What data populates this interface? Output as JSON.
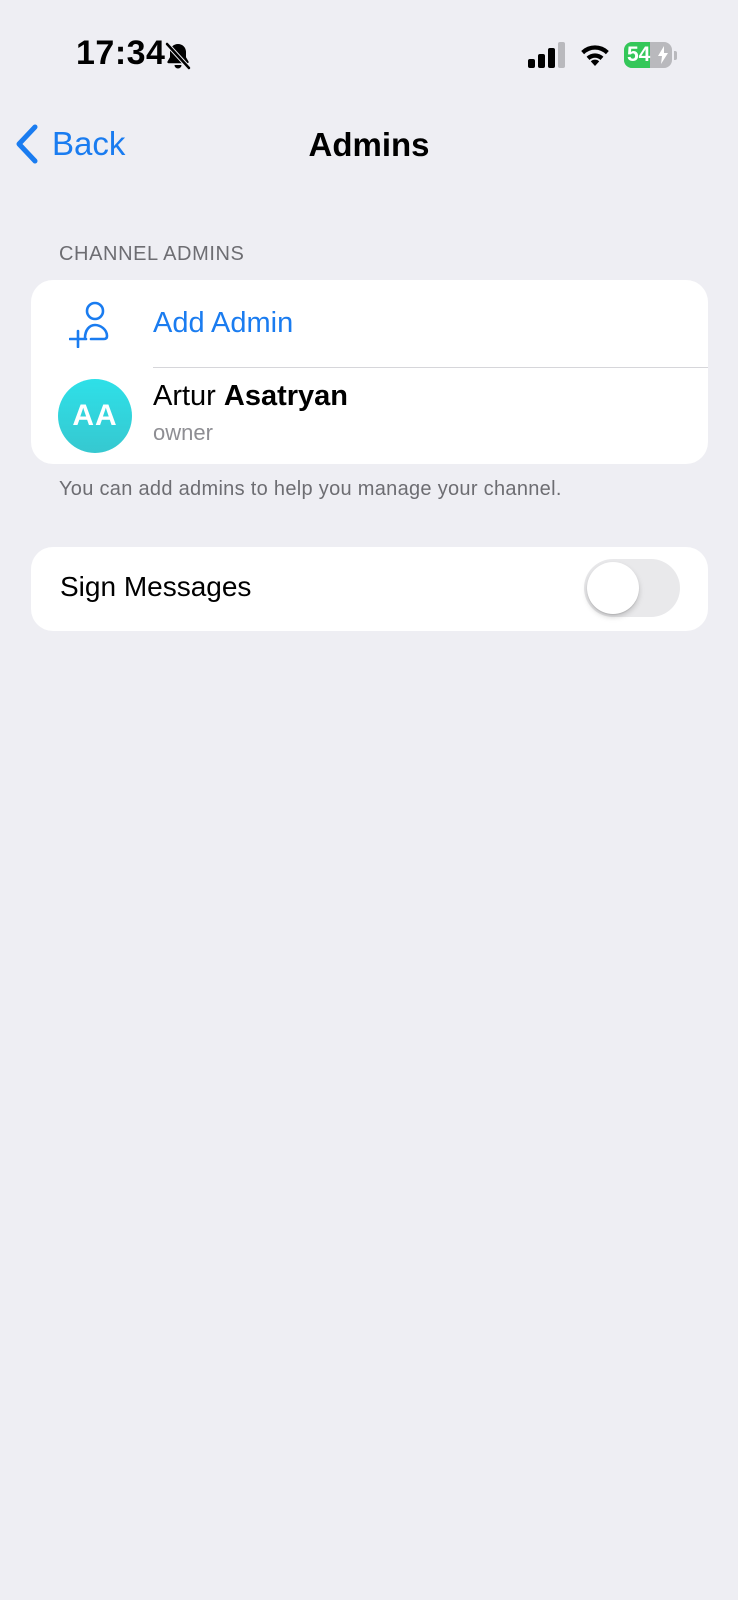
{
  "status_bar": {
    "time": "17:34",
    "battery_level": "54",
    "battery_fraction": 0.54,
    "icons": [
      "bell-slash-icon",
      "cellular-signal-icon",
      "wifi-icon",
      "battery-charging-icon"
    ]
  },
  "nav": {
    "back_label": "Back",
    "title": "Admins"
  },
  "channel_admins": {
    "header": "CHANNEL ADMINS",
    "add_admin_label": "Add Admin",
    "admins": [
      {
        "initials": "AA",
        "first_name": "Artur",
        "last_name": "Asatryan",
        "role": "owner"
      }
    ],
    "footer": "You can add admins to help you manage your channel."
  },
  "sign_messages": {
    "label": "Sign Messages",
    "enabled": false
  },
  "colors": {
    "accent": "#1a7cf0",
    "background": "#eeeef3",
    "avatar": "#2ee0e8",
    "battery_fill": "#34c759"
  }
}
